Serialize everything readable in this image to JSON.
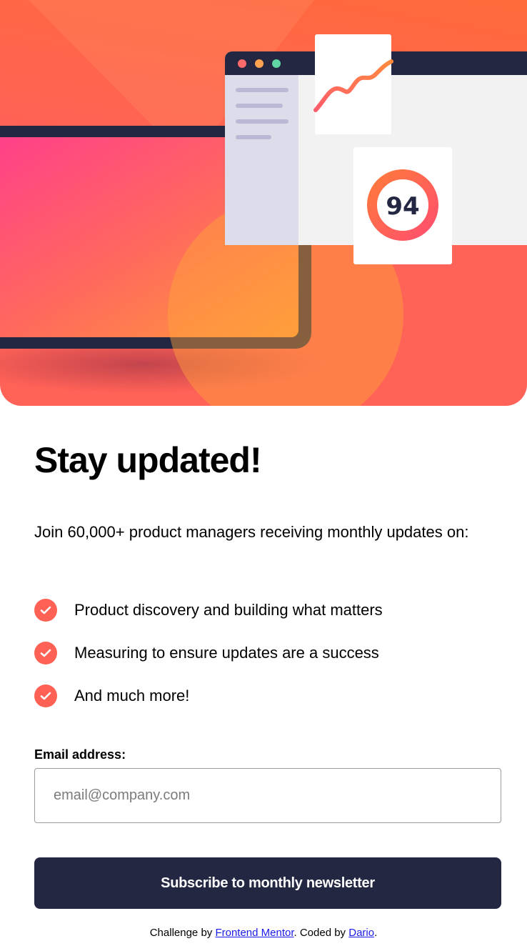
{
  "colors": {
    "accent": "#ff6155",
    "dark_navy": "#242742",
    "link": "#1a1ae8"
  },
  "hero": {
    "score_value": "94",
    "icons": [
      "laptop-illustration",
      "browser-window-illustration",
      "trend-chart-card",
      "score-ring-card"
    ]
  },
  "main": {
    "title": "Stay updated!",
    "intro": "Join 60,000+ product managers receiving monthly updates on:",
    "features": [
      {
        "icon": "check-icon",
        "text": "Product discovery and building what matters"
      },
      {
        "icon": "check-icon",
        "text": "Measuring to ensure updates are a success"
      },
      {
        "icon": "check-icon",
        "text": "And much more!"
      }
    ]
  },
  "form": {
    "email_label": "Email address:",
    "email_placeholder": "email@company.com",
    "email_value": "",
    "submit_label": "Subscribe to monthly newsletter"
  },
  "footer": {
    "prefix": "Challenge by ",
    "challenge_link": "Frontend Mentor",
    "middle": ". Coded by ",
    "author_link": "Dario",
    "suffix": "."
  }
}
